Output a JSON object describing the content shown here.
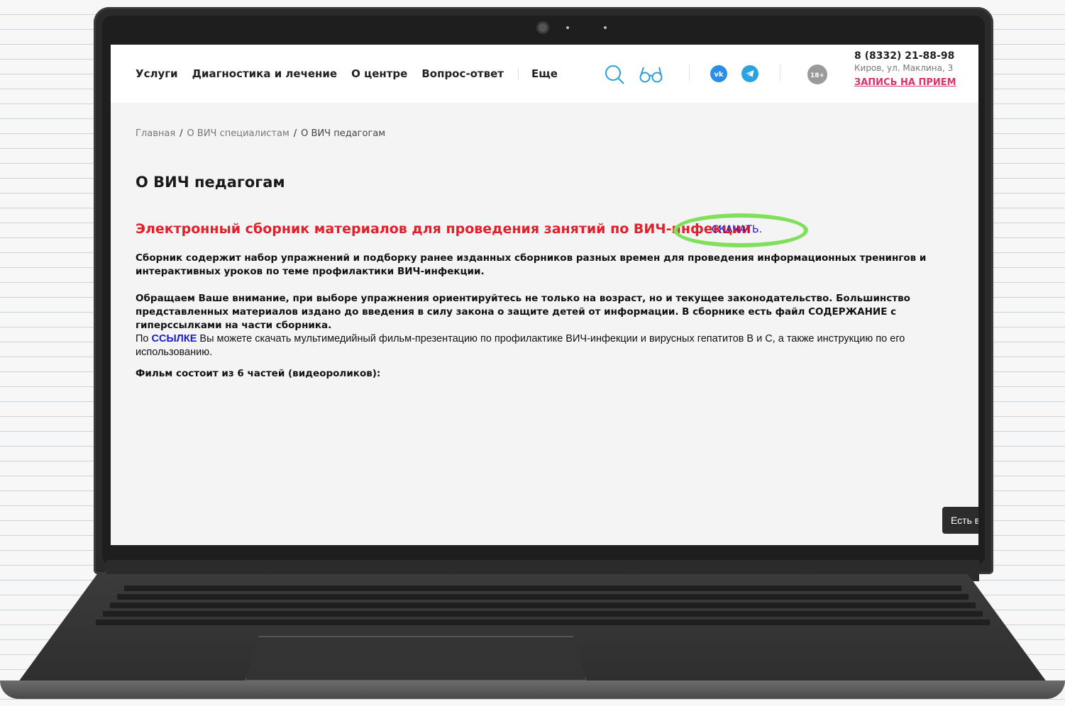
{
  "header": {
    "nav": [
      "Услуги",
      "Диагностика и лечение",
      "О центре",
      "Вопрос-ответ",
      "Еще"
    ],
    "age_badge": "18+",
    "phone": "8 (8332) 21-88-98",
    "address": "Киров, ул. Маклина, 3",
    "booking": "ЗАПИСЬ НА ПРИЕМ",
    "icons": [
      "search-icon",
      "glasses-icon",
      "vk-icon",
      "telegram-icon"
    ]
  },
  "breadcrumb": {
    "home": "Главная",
    "section": "О ВИЧ специалистам",
    "current": "О ВИЧ педагогам"
  },
  "page": {
    "title": "О ВИЧ педагогам",
    "headline": "Электронный сборник материалов для проведения занятий по ВИЧ-инфекции",
    "download": "СКАЧАТЬ.",
    "para1": "Сборник содержит набор упражнений и подборку ранее изданных сборников разных времен для проведения информационных тренингов и интерактивных уроков по теме профилактики ВИЧ-инфекции.",
    "para2": "Обращаем Ваше внимание, при выборе упражнения ориентируйтесь не только на возраст, но и текущее законодательство. Большинство представленных материалов издано до введения в силу закона о защите детей от информации. В сборнике есть файл СОДЕРЖАНИЕ с гиперссылками на части сборника.",
    "para3_prefix": "По",
    "para3_link": "ССЫЛКЕ",
    "para3_rest": "Вы можете скачать мультимедийный фильм-презентацию по профилактике ВИЧ-инфекции и вирусных гепатитов В и С, а также инструкцию по его использованию.",
    "film_heading": "Фильм состоит из 6 частей (видеороликов):"
  },
  "chat_tab": "Есть вопрос?",
  "colors": {
    "headline_red": "#e0202a",
    "link_blue": "#1a1acc",
    "booking_pink": "#d6336c",
    "highlight_green": "#7fe05a"
  }
}
